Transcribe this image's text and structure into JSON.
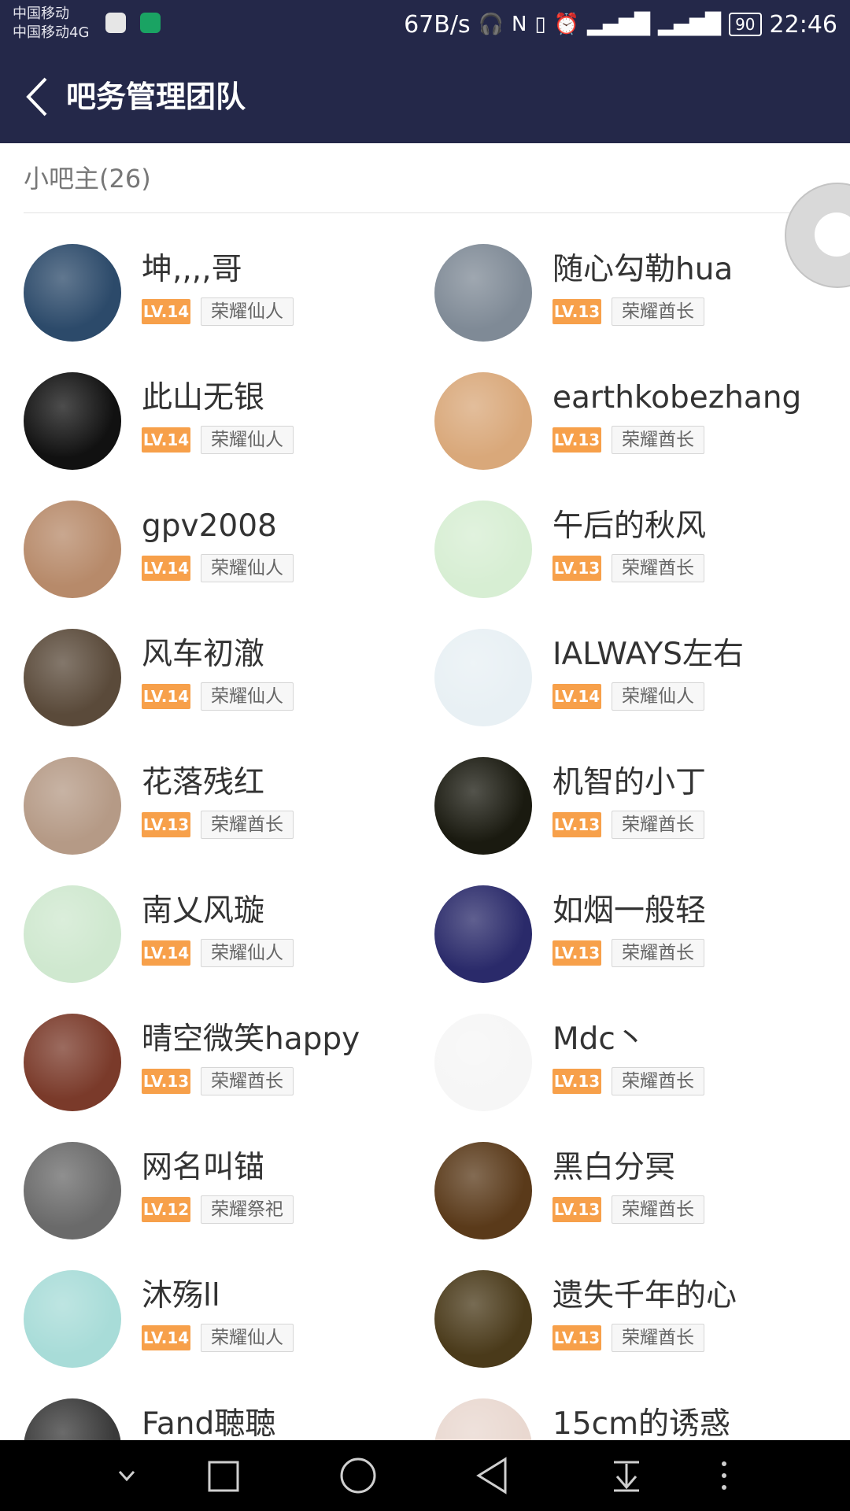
{
  "status_bar": {
    "carrier_1": "中国移动",
    "carrier_2": "中国移动4G",
    "speed": "67B/s",
    "battery": "90",
    "time": "22:46",
    "icons": [
      "headphones-icon",
      "nfc-icon",
      "vibrate-icon",
      "alarm-icon",
      "signal-icon",
      "signal-4g-icon",
      "battery-icon"
    ]
  },
  "header": {
    "title": "吧务管理团队",
    "back_icon": "chevron-left-icon"
  },
  "section": {
    "label": "小吧主(26)"
  },
  "members": [
    {
      "name": "坤,,,,哥",
      "level": "LV.14",
      "rank": "荣耀仙人",
      "color": "#2c4a6a"
    },
    {
      "name": "随心勾勒hua",
      "level": "LV.13",
      "rank": "荣耀酋长",
      "color": "#7f8a96"
    },
    {
      "name": "此山无银",
      "level": "LV.14",
      "rank": "荣耀仙人",
      "color": "#111111"
    },
    {
      "name": "earthkobezhang",
      "level": "LV.13",
      "rank": "荣耀酋长",
      "color": "#d9a87a"
    },
    {
      "name": "gpv2008",
      "level": "LV.14",
      "rank": "荣耀仙人",
      "color": "#b78a6a"
    },
    {
      "name": "午后的秋风",
      "level": "LV.13",
      "rank": "荣耀酋长",
      "color": "#d7eed3"
    },
    {
      "name": "风车初澈",
      "level": "LV.14",
      "rank": "荣耀仙人",
      "color": "#5a4a3a"
    },
    {
      "name": "IALWAYS左右",
      "level": "LV.14",
      "rank": "荣耀仙人",
      "color": "#e8f0f4"
    },
    {
      "name": "花落残红",
      "level": "LV.13",
      "rank": "荣耀酋长",
      "color": "#b59a86"
    },
    {
      "name": "机智的小丁",
      "level": "LV.13",
      "rank": "荣耀酋长",
      "color": "#1a1a10"
    },
    {
      "name": "南乂风璇",
      "level": "LV.14",
      "rank": "荣耀仙人",
      "color": "#cfe8cf"
    },
    {
      "name": "如烟一般轻",
      "level": "LV.13",
      "rank": "荣耀酋长",
      "color": "#2a2a6a"
    },
    {
      "name": "晴空微笑happy",
      "level": "LV.13",
      "rank": "荣耀酋长",
      "color": "#7a3a2a"
    },
    {
      "name": "Mdc丶",
      "level": "LV.13",
      "rank": "荣耀酋长",
      "color": "#f6f6f6"
    },
    {
      "name": "网名叫锚",
      "level": "LV.12",
      "rank": "荣耀祭祀",
      "color": "#6a6a6a"
    },
    {
      "name": "黑白分冥",
      "level": "LV.13",
      "rank": "荣耀酋长",
      "color": "#5a3a1a"
    },
    {
      "name": "沐殇ll",
      "level": "LV.14",
      "rank": "荣耀仙人",
      "color": "#a8dcd8"
    },
    {
      "name": "遗失千年的心",
      "level": "LV.13",
      "rank": "荣耀酋长",
      "color": "#4a3a1a"
    },
    {
      "name": "Fand聴聴",
      "level": "",
      "rank": "",
      "color": "#3a3a3a"
    },
    {
      "name": "15cm的诱惑",
      "level": "",
      "rank": "",
      "color": "#e9d8d0"
    }
  ],
  "nav_bar": {
    "icons": [
      "chevron-down-icon",
      "square-icon",
      "circle-icon",
      "triangle-back-icon",
      "download-icon",
      "more-dots-icon"
    ]
  }
}
